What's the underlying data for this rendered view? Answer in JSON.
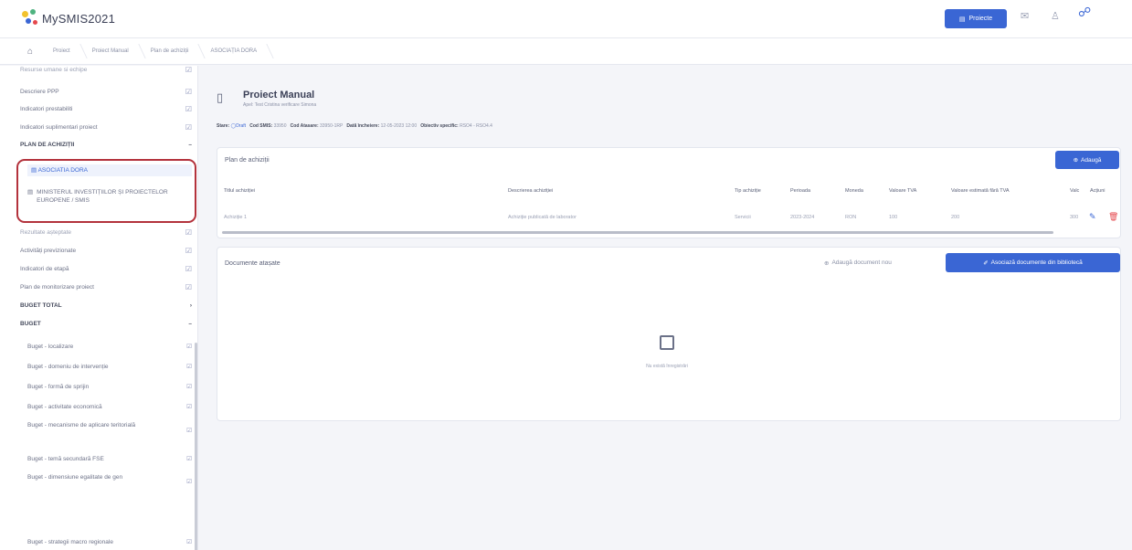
{
  "app": {
    "name": "MySMIS2021",
    "brand_colors": [
      "#f2c22e",
      "#3a66d4",
      "#4fb380",
      "#e5484d"
    ]
  },
  "topbar": {
    "projects_button": "Proiecte",
    "icons": [
      "mail-icon",
      "user-icon",
      "notification-icon"
    ]
  },
  "breadcrumb": [
    "Proiect",
    "Proiect Manual",
    "Plan de achiziții",
    "ASOCIAȚIA DORA"
  ],
  "sidebar": {
    "items": [
      {
        "label": "Resurse umane si echipe",
        "heading": false
      },
      {
        "label": "Descriere PPP",
        "heading": false
      },
      {
        "label": "Indicatori prestabiliti",
        "heading": false
      },
      {
        "label": "Indicatori suplimentari proiect",
        "heading": false
      },
      {
        "label": "PLAN DE ACHIZIȚII",
        "heading": true
      },
      {
        "label": "ASOCIATIA DORA",
        "heading": false,
        "sub": true,
        "active": true
      },
      {
        "label": "MINISTERUL INVESTIȚIILOR ȘI PROIECTELOR EUROPENE / SMIS",
        "heading": false,
        "sub": true
      },
      {
        "label": "Rezultate așteptate",
        "heading": false
      },
      {
        "label": "Activități previzionate",
        "heading": false
      },
      {
        "label": "Indicatori de etapă",
        "heading": false
      },
      {
        "label": "Plan de monitorizare proiect",
        "heading": false
      },
      {
        "label": "BUGET TOTAL",
        "heading": true
      },
      {
        "label": "BUGET",
        "heading": true
      },
      {
        "label": "Buget - localizare",
        "heading": false,
        "sub": true
      },
      {
        "label": "Buget - domeniu de intervenție",
        "heading": false,
        "sub": true
      },
      {
        "label": "Buget - formă de sprijin",
        "heading": false,
        "sub": true
      },
      {
        "label": "Buget - activitate economică",
        "heading": false,
        "sub": true
      },
      {
        "label": "Buget - mecanisme de aplicare teritorială",
        "heading": false,
        "sub": true
      },
      {
        "label": "Buget - temă secundară FSE",
        "heading": false,
        "sub": true
      },
      {
        "label": "Buget - dimensiune egalitate de gen",
        "heading": false,
        "sub": true
      },
      {
        "label": "Buget - strategii macro regionale",
        "heading": false,
        "sub": true
      }
    ]
  },
  "project": {
    "title": "Proiect Manual",
    "subtitle": "Apel: Test Cristina verificare Simona",
    "meta": {
      "stare_label": "Stare:",
      "stare_value": "Draft",
      "cod_smis_label": "Cod SMIS:",
      "cod_smis_value": "33950",
      "cod_atasare_label": "Cod Atasare:",
      "cod_atasare_value": "33950-1RP",
      "data_incheiere_label": "Dată încheiere:",
      "data_incheiere_value": "12-05-2023 12:00",
      "obiectiv_label": "Obiectiv specific:",
      "obiectiv_value": "RSO4 - RSO4.4"
    }
  },
  "plan": {
    "title": "Plan de achiziții",
    "add_button": "Adaugă",
    "columns": [
      "Titlul achiziției",
      "Descrierea achiziției",
      "Tip achiziție",
      "Perioada",
      "Moneda",
      "Valoare TVA",
      "Valoare estimată fără TVA",
      "Valc",
      "Acțiuni"
    ],
    "rows": [
      {
        "titlu": "Achiziție 1",
        "descriere": "Achiziție publicată de laborator",
        "tip": "Servicii",
        "perioada": "2023-2024",
        "moneda": "RON",
        "tva": "100",
        "fara_tva": "200",
        "valc": "300"
      }
    ]
  },
  "documents": {
    "title": "Documente atașate",
    "add_new": "Adaugă document nou",
    "associate_button": "Asociază documente din bibliotecă",
    "empty_text": "Nu există înregistrări"
  }
}
